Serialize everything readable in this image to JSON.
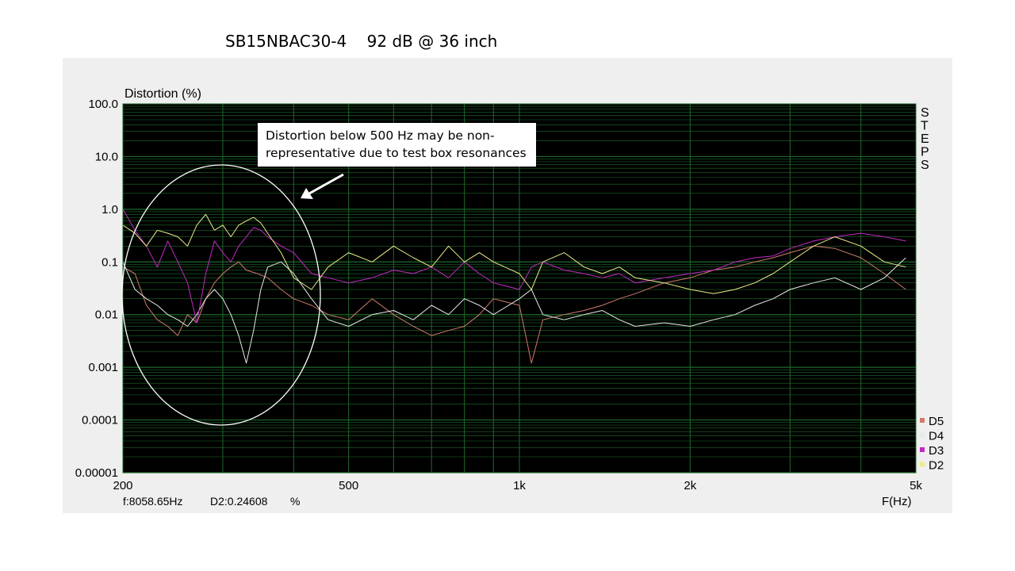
{
  "page_title": "SB15NBAC30-4    92 dB @ 36 inch",
  "annotation": "Distortion below 500 Hz may be non-representative due to test box resonances",
  "side_label": "STEPS",
  "cursor_readout": {
    "freq": "f:8058.65Hz",
    "value": "D2:0.24608",
    "unit": "%"
  },
  "colors": {
    "plot_bg": "#000000",
    "grid": "#1f6a2a",
    "D2": "#ecec8a",
    "D3": "#c428c4",
    "D4": "#e8e8e8",
    "D5": "#d07a6e",
    "highlight": "#ffffff"
  },
  "chart_data": {
    "type": "line",
    "ylabel": "Distortion (%)",
    "xlabel": "F(Hz)",
    "x_scale": "log",
    "y_scale": "log",
    "xlim": [
      200,
      5000
    ],
    "ylim": [
      1e-05,
      100
    ],
    "x_ticks": [
      {
        "value": 200,
        "label": "200"
      },
      {
        "value": 500,
        "label": "500"
      },
      {
        "value": 1000,
        "label": "1k"
      },
      {
        "value": 2000,
        "label": "2k"
      },
      {
        "value": 5000,
        "label": "5k"
      }
    ],
    "y_ticks": [
      {
        "value": 100,
        "label": "100.0"
      },
      {
        "value": 10,
        "label": "10.0"
      },
      {
        "value": 1,
        "label": "1.0"
      },
      {
        "value": 0.1,
        "label": "0.1"
      },
      {
        "value": 0.01,
        "label": "0.01"
      },
      {
        "value": 0.001,
        "label": "0.001"
      },
      {
        "value": 0.0001,
        "label": "0.0001"
      },
      {
        "value": 1e-05,
        "label": "0.00001"
      }
    ],
    "grid": true,
    "legend_position": "bottom-right",
    "series": [
      {
        "name": "D5",
        "x": [
          200,
          210,
          220,
          230,
          240,
          250,
          260,
          270,
          280,
          290,
          300,
          310,
          320,
          330,
          345,
          360,
          380,
          400,
          430,
          460,
          500,
          550,
          600,
          650,
          700,
          750,
          800,
          850,
          900,
          1000,
          1050,
          1100,
          1200,
          1300,
          1400,
          1500,
          1600,
          1800,
          2000,
          2200,
          2400,
          2600,
          2800,
          3000,
          3300,
          3600,
          4000,
          4400,
          4800
        ],
        "y": [
          0.08,
          0.06,
          0.015,
          0.008,
          0.006,
          0.004,
          0.01,
          0.007,
          0.02,
          0.04,
          0.06,
          0.08,
          0.1,
          0.07,
          0.06,
          0.05,
          0.03,
          0.02,
          0.015,
          0.01,
          0.008,
          0.02,
          0.01,
          0.006,
          0.004,
          0.005,
          0.006,
          0.01,
          0.02,
          0.015,
          0.0012,
          0.008,
          0.01,
          0.012,
          0.015,
          0.02,
          0.025,
          0.04,
          0.05,
          0.07,
          0.08,
          0.1,
          0.12,
          0.15,
          0.2,
          0.18,
          0.12,
          0.06,
          0.03
        ]
      },
      {
        "name": "D4",
        "x": [
          200,
          210,
          220,
          230,
          240,
          250,
          260,
          270,
          280,
          290,
          300,
          310,
          320,
          330,
          340,
          350,
          360,
          380,
          400,
          430,
          460,
          500,
          550,
          600,
          650,
          700,
          750,
          800,
          850,
          900,
          1000,
          1050,
          1100,
          1200,
          1300,
          1400,
          1500,
          1600,
          1800,
          2000,
          2200,
          2400,
          2600,
          2800,
          3000,
          3300,
          3600,
          4000,
          4400,
          4800
        ],
        "y": [
          0.1,
          0.03,
          0.02,
          0.015,
          0.01,
          0.008,
          0.006,
          0.01,
          0.02,
          0.03,
          0.02,
          0.01,
          0.004,
          0.0012,
          0.005,
          0.03,
          0.08,
          0.1,
          0.06,
          0.02,
          0.008,
          0.006,
          0.01,
          0.012,
          0.008,
          0.015,
          0.01,
          0.02,
          0.015,
          0.01,
          0.02,
          0.03,
          0.01,
          0.008,
          0.01,
          0.012,
          0.008,
          0.006,
          0.007,
          0.006,
          0.008,
          0.01,
          0.015,
          0.02,
          0.03,
          0.04,
          0.05,
          0.03,
          0.05,
          0.12
        ]
      },
      {
        "name": "D3",
        "x": [
          200,
          210,
          220,
          230,
          240,
          250,
          260,
          270,
          280,
          290,
          300,
          310,
          320,
          330,
          340,
          350,
          360,
          380,
          400,
          430,
          460,
          500,
          550,
          600,
          650,
          700,
          750,
          800,
          850,
          900,
          1000,
          1050,
          1100,
          1200,
          1300,
          1400,
          1500,
          1600,
          1800,
          2000,
          2200,
          2400,
          2600,
          2800,
          3000,
          3300,
          3600,
          4000,
          4400,
          4800
        ],
        "y": [
          1.0,
          0.4,
          0.2,
          0.08,
          0.25,
          0.1,
          0.04,
          0.007,
          0.06,
          0.25,
          0.15,
          0.1,
          0.2,
          0.3,
          0.45,
          0.4,
          0.3,
          0.2,
          0.15,
          0.06,
          0.05,
          0.04,
          0.05,
          0.07,
          0.06,
          0.08,
          0.05,
          0.1,
          0.06,
          0.04,
          0.03,
          0.08,
          0.1,
          0.07,
          0.06,
          0.05,
          0.06,
          0.04,
          0.05,
          0.06,
          0.07,
          0.1,
          0.12,
          0.13,
          0.18,
          0.25,
          0.3,
          0.35,
          0.3,
          0.25
        ]
      },
      {
        "name": "D2",
        "x": [
          200,
          210,
          220,
          230,
          240,
          250,
          260,
          270,
          280,
          290,
          300,
          310,
          320,
          330,
          340,
          350,
          360,
          380,
          400,
          430,
          460,
          500,
          550,
          600,
          650,
          700,
          750,
          800,
          850,
          900,
          1000,
          1050,
          1100,
          1200,
          1300,
          1400,
          1500,
          1600,
          1800,
          2000,
          2200,
          2400,
          2600,
          2800,
          3000,
          3300,
          3600,
          4000,
          4400,
          4800
        ],
        "y": [
          0.5,
          0.35,
          0.2,
          0.4,
          0.35,
          0.3,
          0.2,
          0.5,
          0.8,
          0.4,
          0.5,
          0.3,
          0.5,
          0.6,
          0.7,
          0.55,
          0.35,
          0.15,
          0.05,
          0.03,
          0.08,
          0.15,
          0.1,
          0.2,
          0.12,
          0.08,
          0.2,
          0.1,
          0.15,
          0.1,
          0.06,
          0.03,
          0.1,
          0.15,
          0.08,
          0.06,
          0.08,
          0.05,
          0.04,
          0.03,
          0.025,
          0.03,
          0.04,
          0.06,
          0.1,
          0.2,
          0.3,
          0.2,
          0.1,
          0.08
        ]
      }
    ]
  }
}
